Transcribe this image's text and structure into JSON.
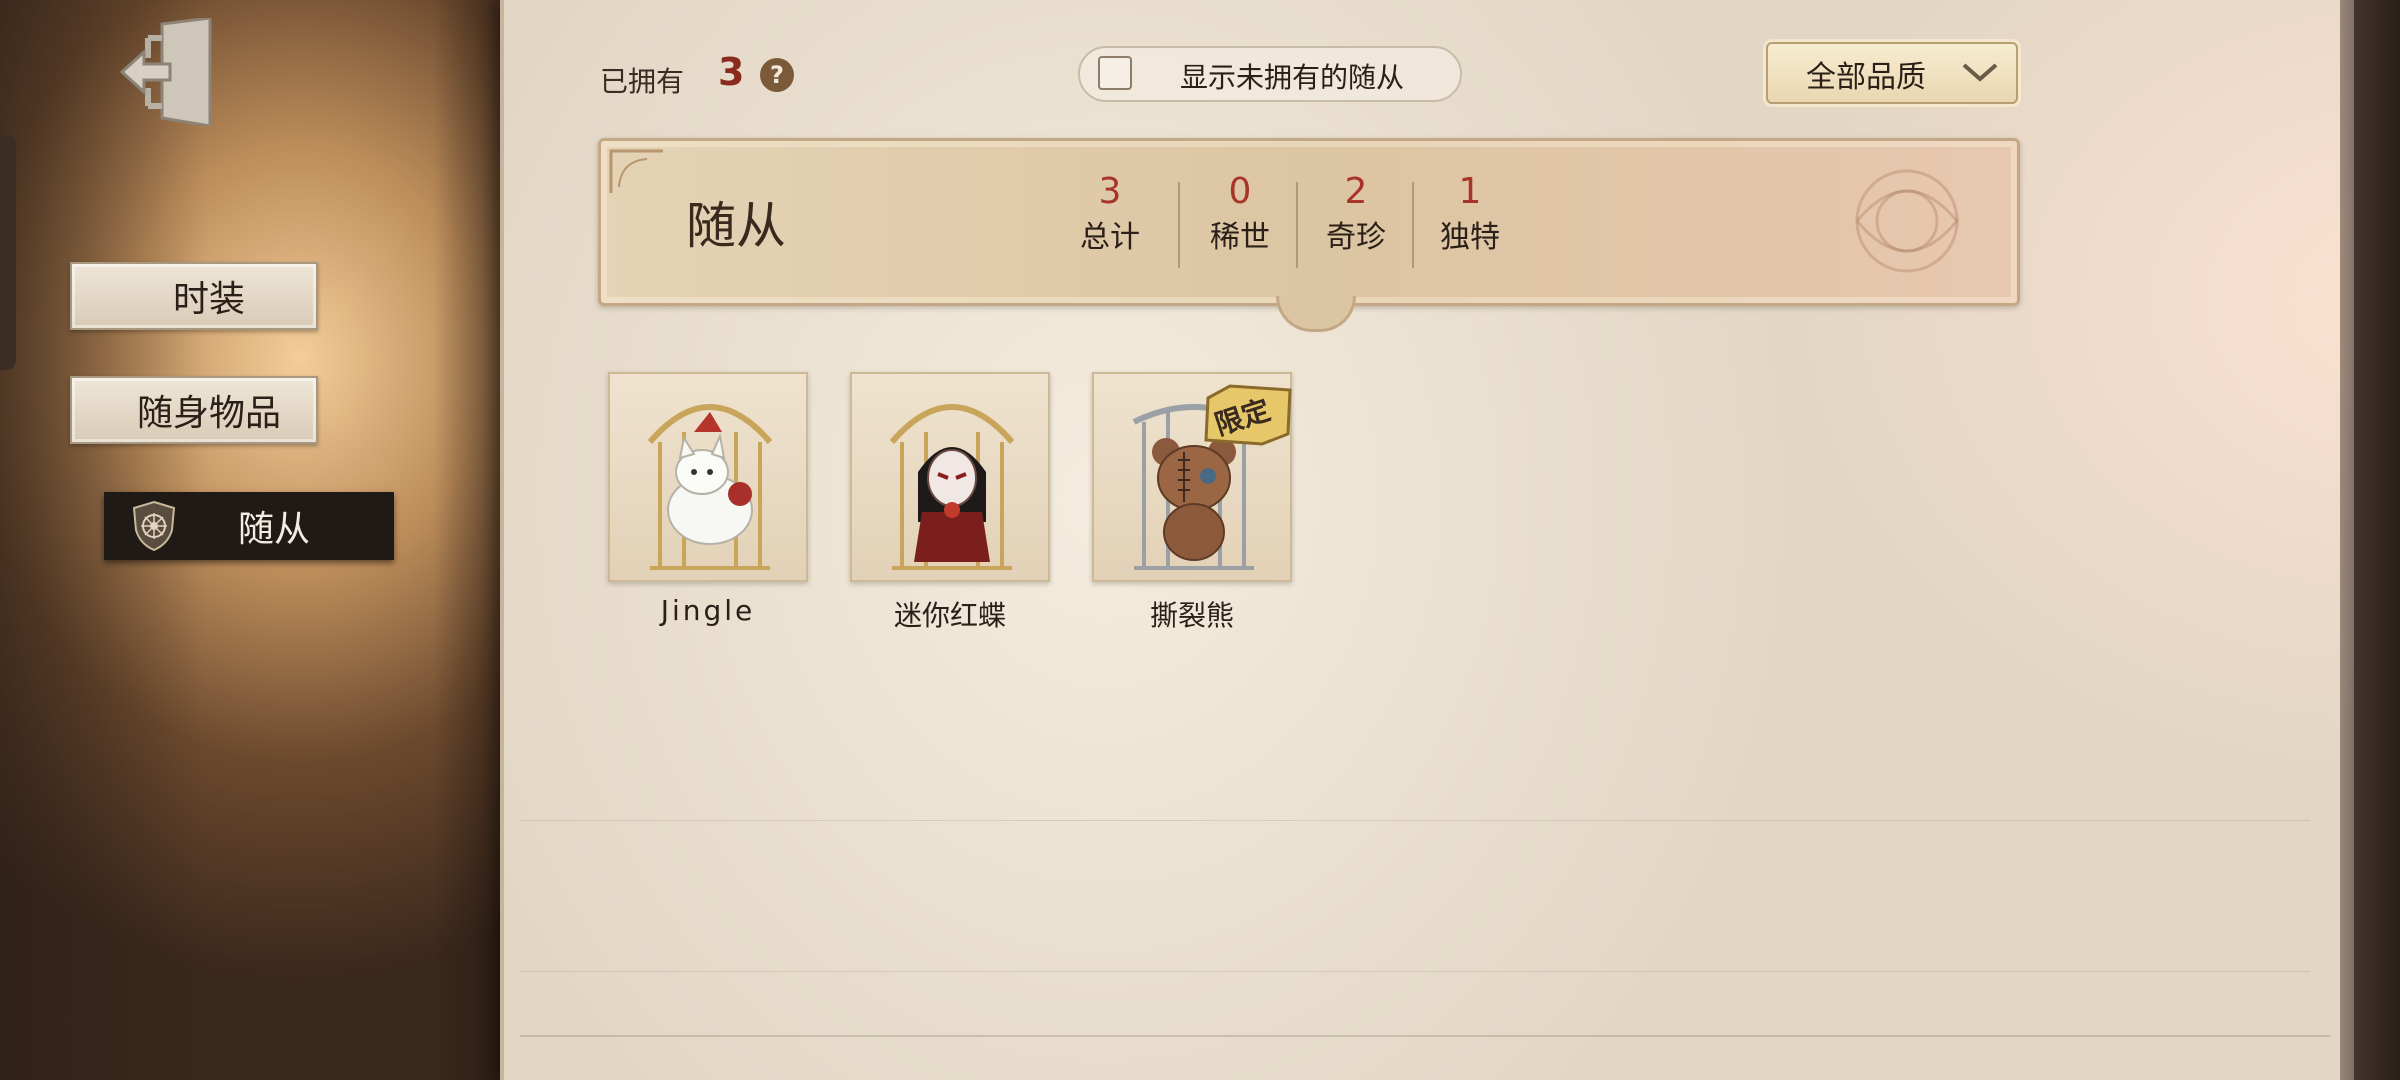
{
  "sidebar": {
    "items": [
      {
        "label": "时装",
        "active": false
      },
      {
        "label": "随身物品",
        "active": false
      },
      {
        "label": "随从",
        "active": true
      }
    ]
  },
  "topbar": {
    "owned_label": "已拥有",
    "owned_count": "3",
    "help_icon": "?",
    "toggle_label": "显示未拥有的随从",
    "toggle_checked": false,
    "quality_filter": "全部品质"
  },
  "summary": {
    "title": "随从",
    "stats": [
      {
        "value": "3",
        "label": "总计"
      },
      {
        "value": "0",
        "label": "稀世"
      },
      {
        "value": "2",
        "label": "奇珍"
      },
      {
        "value": "1",
        "label": "独特"
      }
    ]
  },
  "companions": [
    {
      "name": "Jingle",
      "icon": "white-fox-companion"
    },
    {
      "name": "迷你红蝶",
      "icon": "red-butterfly-companion"
    },
    {
      "name": "撕裂熊",
      "icon": "torn-bear-companion",
      "badge": "限定"
    }
  ],
  "colors": {
    "accent_red": "#a8352a",
    "paper": "#e6dac8",
    "dark_button": "#1f1a16"
  }
}
